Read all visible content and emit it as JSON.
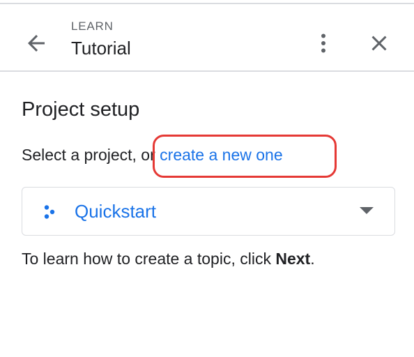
{
  "header": {
    "eyebrow": "LEARN",
    "title": "Tutorial",
    "back_icon": "arrow-back-icon",
    "more_icon": "more-vert-icon",
    "close_icon": "close-icon"
  },
  "main": {
    "section_title": "Project setup",
    "select_prefix": "Select a project, or ",
    "create_link": "create a new one",
    "project_select": {
      "selected": "Quickstart",
      "icon": "project-dots-icon"
    },
    "hint_prefix": "To learn how to create a topic, click ",
    "hint_bold": "Next",
    "hint_suffix": "."
  },
  "colors": {
    "accent": "#1a73e8",
    "highlight": "#e53935",
    "text": "#202124",
    "muted": "#5f6368",
    "divider": "#dadce0"
  }
}
